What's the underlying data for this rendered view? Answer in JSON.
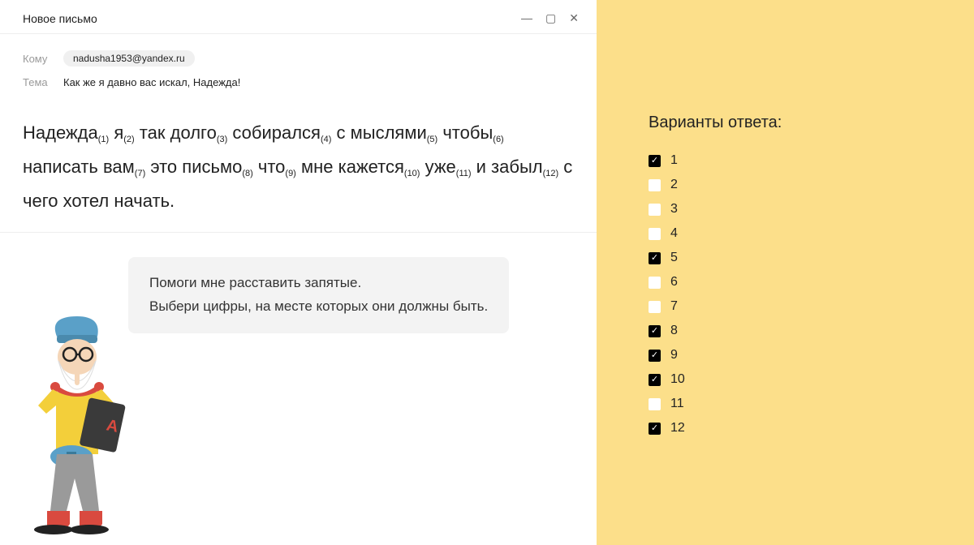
{
  "email": {
    "window_title": "Новое письмо",
    "to_label": "Кому",
    "recipient": "nadusha1953@yandex.ru",
    "subject_label": "Тема",
    "subject": "Как же я давно вас искал, Надежда!"
  },
  "sentence": {
    "parts": [
      {
        "text": "Надежда",
        "n": "(1)"
      },
      {
        "text": " я",
        "n": "(2)"
      },
      {
        "text": " так долго",
        "n": "(3)"
      },
      {
        "text": " собирался",
        "n": "(4)"
      },
      {
        "text": " с мыслями",
        "n": "(5)"
      },
      {
        "text": " чтобы",
        "n": "(6)"
      },
      {
        "text": " написать вам",
        "n": "(7)"
      },
      {
        "text": " это письмо",
        "n": "(8)"
      },
      {
        "text": " что",
        "n": "(9)"
      },
      {
        "text": " мне кажется",
        "n": "(10)"
      },
      {
        "text": " уже",
        "n": "(11)"
      },
      {
        "text": " и забыл",
        "n": "(12)"
      },
      {
        "text": " с чего хотел начать.",
        "n": ""
      }
    ]
  },
  "hint": {
    "line1": "Помоги мне расставить запятые.",
    "line2": "Выбери цифры, на месте которых они должны быть."
  },
  "answers": {
    "title": "Варианты ответа:",
    "options": [
      {
        "label": "1",
        "checked": true
      },
      {
        "label": "2",
        "checked": false
      },
      {
        "label": "3",
        "checked": false
      },
      {
        "label": "4",
        "checked": false
      },
      {
        "label": "5",
        "checked": true
      },
      {
        "label": "6",
        "checked": false
      },
      {
        "label": "7",
        "checked": false
      },
      {
        "label": "8",
        "checked": true
      },
      {
        "label": "9",
        "checked": true
      },
      {
        "label": "10",
        "checked": true
      },
      {
        "label": "11",
        "checked": false
      },
      {
        "label": "12",
        "checked": true
      }
    ]
  },
  "window_controls": {
    "min": "—",
    "max": "▢",
    "close": "✕"
  }
}
